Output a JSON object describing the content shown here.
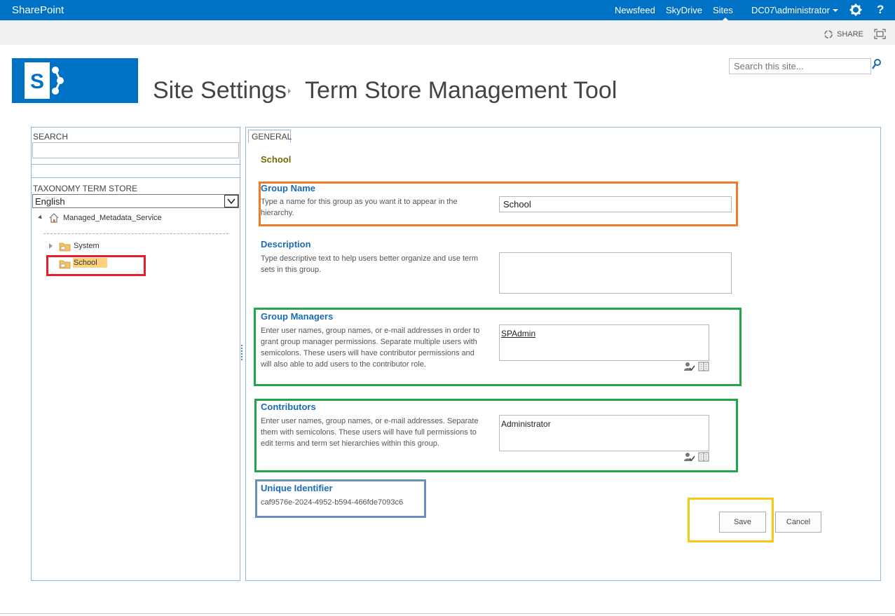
{
  "suite_bar": {
    "brand": "SharePoint",
    "links": [
      "Newsfeed",
      "SkyDrive",
      "Sites"
    ],
    "user": "DC07\\administrator",
    "help": "?"
  },
  "ribbon": {
    "share_label": "SHARE"
  },
  "header": {
    "crumb": "Site Settings",
    "page_title": "Term Store Management Tool",
    "search_placeholder": "Search this site..."
  },
  "left_panel": {
    "search_label": "SEARCH",
    "taxonomy_label": "TAXONOMY TERM STORE",
    "language": "English",
    "tree": {
      "root": "Managed_Metadata_Service",
      "children": [
        "System",
        "School"
      ]
    }
  },
  "right_panel": {
    "tab": "GENERAL",
    "group_title": "School",
    "group_name": {
      "title": "Group Name",
      "desc": "Type a name for this group as you want it to appear in the hierarchy.",
      "value": "School"
    },
    "description": {
      "title": "Description",
      "desc": "Type descriptive text to help users better organize and use term sets in this group.",
      "value": ""
    },
    "group_managers": {
      "title": "Group Managers",
      "desc": "Enter user names, group names, or e-mail addresses in order to grant group manager permissions. Separate multiple users with semicolons. These users will have contributor permissions and will also able to add users to the contributor role.",
      "value": "SPAdmin"
    },
    "contributors": {
      "title": "Contributors",
      "desc": "Enter user names, group names, or e-mail addresses. Separate them with semicolons. These users will have full permissions to edit terms and term set hierarchies within this group.",
      "value": "Administrator"
    },
    "unique_identifier": {
      "title": "Unique Identifier",
      "value": "caf9576e-2024-4952-b594-466fde7093c6"
    },
    "buttons": {
      "save": "Save",
      "cancel": "Cancel"
    }
  },
  "colors": {
    "suite_blue": "#0072c6",
    "title_blue": "#1c6bb8",
    "highlight_red": "#e4212b",
    "highlight_orange": "#f07b2b",
    "highlight_green": "#22a64a",
    "highlight_blue": "#6e8fb7",
    "highlight_yellow": "#f6c817"
  },
  "icons": [
    "sharepoint-logo",
    "settings-gear",
    "help",
    "share",
    "focus-on-content",
    "search",
    "home",
    "folder",
    "check-names",
    "browse-address-book"
  ]
}
